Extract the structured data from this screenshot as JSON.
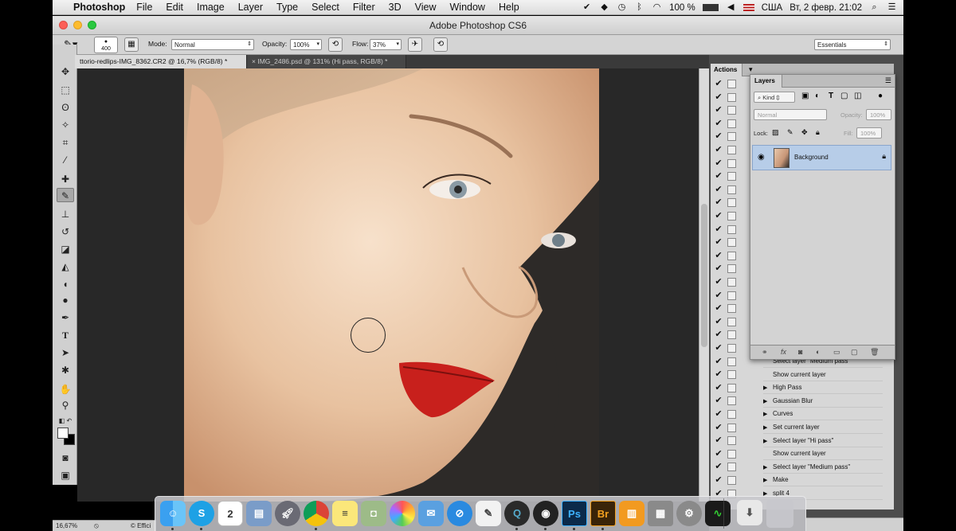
{
  "menubar": {
    "apple_icon": "apple-icon",
    "app_name": "Photoshop",
    "items": [
      "File",
      "Edit",
      "Image",
      "Layer",
      "Type",
      "Select",
      "Filter",
      "3D",
      "View",
      "Window",
      "Help"
    ],
    "status": {
      "battery": "100 %",
      "input_source": "США",
      "clock": "Вт, 2 февр.  21:02"
    }
  },
  "window": {
    "title": "Adobe Photoshop CS6"
  },
  "options_bar": {
    "brush_size": "400",
    "mode_label": "Mode:",
    "mode_value": "Normal",
    "opacity_label": "Opacity:",
    "opacity_value": "100%",
    "flow_label": "Flow:",
    "flow_value": "37%",
    "workspace": "Essentials"
  },
  "documents": {
    "tabs": [
      {
        "label": "ttorio-redlips-IMG_8362.CR2 @ 16,7% (RGB/8) *",
        "active": true
      },
      {
        "label": "IMG_2486.psd @ 131% (Hi pass, RGB/8) *",
        "active": false
      }
    ]
  },
  "tools": [
    "move",
    "marquee",
    "lasso",
    "quick-select",
    "crop",
    "eyedropper",
    "spot-healing",
    "brush",
    "clone-stamp",
    "history-brush",
    "eraser",
    "paint-bucket",
    "blur",
    "dodge",
    "pen",
    "type",
    "path-select",
    "shape",
    "hand",
    "zoom"
  ],
  "actions_panel": {
    "tab": "Actions",
    "steps": [
      {
        "label": "Select layer \"Medium pass\"",
        "expandable": false
      },
      {
        "label": "Show current layer",
        "expandable": false
      },
      {
        "label": "High Pass",
        "expandable": true
      },
      {
        "label": "Gaussian Blur",
        "expandable": true
      },
      {
        "label": "Curves",
        "expandable": true
      },
      {
        "label": "Set current layer",
        "expandable": true
      },
      {
        "label": "Select layer \"Hi pass\"",
        "expandable": true
      },
      {
        "label": "Show current layer",
        "expandable": false
      },
      {
        "label": "Select layer \"Medium pass\"",
        "expandable": true
      },
      {
        "label": "Make",
        "expandable": true
      },
      {
        "label": "split 4",
        "expandable": true
      }
    ]
  },
  "layers_panel": {
    "tab": "Layers",
    "filter_kind": "Kind",
    "blend_mode": "Normal",
    "opacity_label": "Opacity:",
    "opacity_value": "100%",
    "lock_label": "Lock:",
    "fill_label": "Fill:",
    "fill_value": "100%",
    "layers": [
      {
        "name": "Background",
        "visible": true,
        "locked": true
      }
    ]
  },
  "status_bar": {
    "zoom": "16,67%",
    "info": "© Effici"
  },
  "dock": {
    "apps": [
      "Finder",
      "Skype",
      "Calendar",
      "Preview",
      "Launchpad",
      "Chrome",
      "Notes",
      "Image Capture",
      "Photos",
      "Mail",
      "Safari",
      "TextEdit",
      "QuickTime",
      "OBS",
      "Ps",
      "Br",
      "iBooks",
      "Calculator",
      "System Preferences",
      "Activity Monitor"
    ],
    "calendar_day": "2",
    "ps_label": "Ps",
    "br_label": "Br"
  },
  "colors": {
    "lips": "#c8201c",
    "layer_selected": "#b7cde8",
    "ps_blue": "#0b2a4a"
  }
}
